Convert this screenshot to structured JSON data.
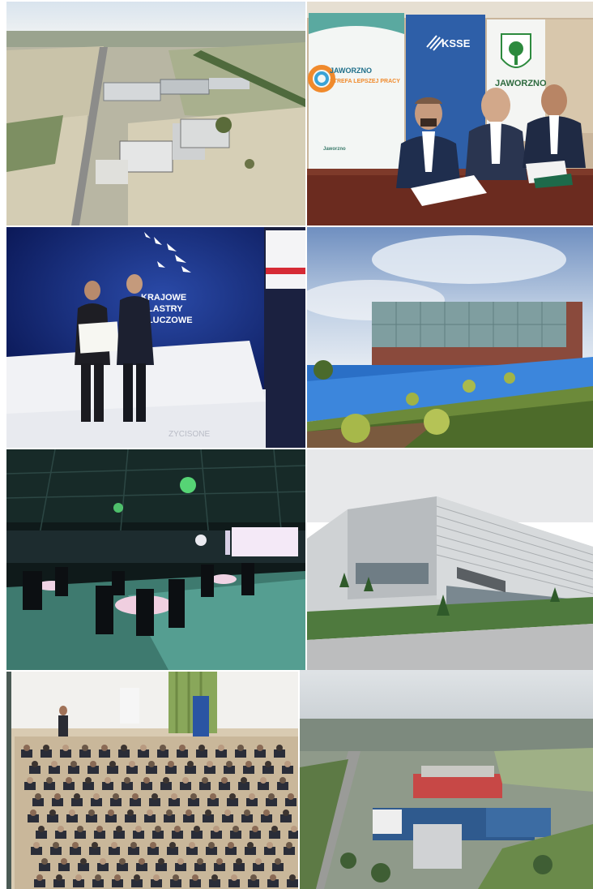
{
  "collage": {
    "signing": {
      "banner_left_line1": "JAWORZNO",
      "banner_left_line2": "STREFA LEPSZEJ PRACY",
      "banner_left_small": "Jaworzno",
      "banner_mid": "KSSE",
      "banner_right": "JAWORZNO"
    },
    "award": {
      "screen_line1": "KRAJOWE",
      "screen_line2": "KLASTRY",
      "screen_line3": "KLUCZOWE",
      "floor_text": "ZYCISONE"
    }
  }
}
